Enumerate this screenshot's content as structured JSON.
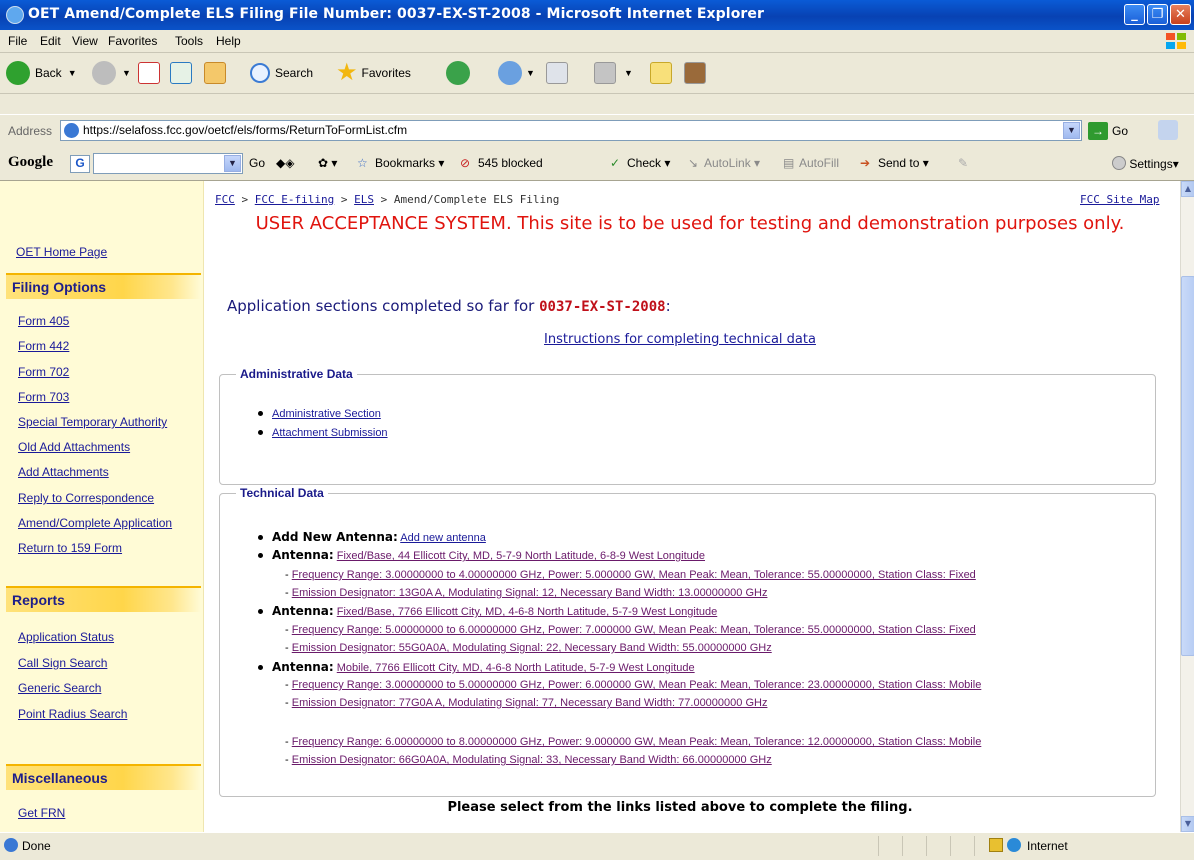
{
  "window": {
    "title": "OET Amend/Complete ELS Filing File Number: 0037-EX-ST-2008 - Microsoft Internet Explorer"
  },
  "menu": [
    "File",
    "Edit",
    "View",
    "Favorites",
    "Tools",
    "Help"
  ],
  "toolbar": {
    "back": "Back",
    "search": "Search",
    "favorites": "Favorites"
  },
  "address": {
    "label": "Address",
    "url": "https://selafoss.fcc.gov/oetcf/els/forms/ReturnToFormList.cfm",
    "go": "Go"
  },
  "google_toolbar": {
    "logo": "Google",
    "go": "Go",
    "bookmarks": "Bookmarks",
    "blocked": "545 blocked",
    "check": "Check",
    "autolink": "AutoLink",
    "autofill": "AutoFill",
    "send_to": "Send to",
    "settings": "Settings"
  },
  "sidebar": {
    "home": "OET Home Page",
    "filing_options_header": "Filing Options",
    "filing_options": [
      "Form 405",
      "Form 442",
      "Form 702",
      "Form 703",
      "Special Temporary Authority",
      "Old Add Attachments",
      "Add Attachments",
      "Reply to Correspondence",
      "Amend/Complete Application",
      "Return to 159 Form"
    ],
    "reports_header": "Reports",
    "reports": [
      "Application Status",
      "Call Sign Search",
      "Generic Search",
      "Point Radius Search"
    ],
    "misc_header": "Miscellaneous",
    "misc": [
      "Get FRN"
    ]
  },
  "breadcrumb": {
    "fcc": "FCC",
    "efiling": "FCC E-filing",
    "els": "ELS",
    "current": "Amend/Complete ELS Filing",
    "sep": " > "
  },
  "site_map": "FCC Site Map",
  "banner": "USER ACCEPTANCE SYSTEM. This site is to be used for testing and demonstration purposes only.",
  "completed_heading": "Application sections completed so far for",
  "file_number": "0037-EX-ST-2008",
  "completed_colon": ":",
  "instructions_link": "Instructions for completing technical data",
  "admin": {
    "legend": "Administrative Data",
    "items": [
      "Administrative Section",
      "Attachment Submission"
    ]
  },
  "technical": {
    "legend": "Technical Data",
    "add_label": "Add New Antenna:",
    "add_link": "Add new antenna",
    "antenna_label": "Antenna:",
    "antennas": [
      {
        "link": "Fixed/Base, 44 Ellicott City, MD, 5-7-9 North Latitude, 6-8-9 West Longitude",
        "freqs": [
          {
            "freq": "Frequency Range: 3.00000000 to 4.00000000 GHz, Power: 5.000000 GW, Mean Peak: Mean, Tolerance: 55.00000000, Station Class: Fixed",
            "emission": "Emission Designator: 13G0A A, Modulating Signal: 12, Necessary Band Width: 13.00000000 GHz"
          }
        ]
      },
      {
        "link": "Fixed/Base, 7766 Ellicott City, MD, 4-6-8 North Latitude, 5-7-9 West Longitude",
        "freqs": [
          {
            "freq": "Frequency Range: 5.00000000 to 6.00000000 GHz, Power: 7.000000 GW, Mean Peak: Mean, Tolerance: 55.00000000, Station Class: Fixed",
            "emission": "Emission Designator: 55G0A0A, Modulating Signal: 22, Necessary Band Width: 55.00000000 GHz"
          }
        ]
      },
      {
        "link": "Mobile, 7766 Ellicott City, MD, 4-6-8 North Latitude, 5-7-9 West Longitude",
        "freqs": [
          {
            "freq": "Frequency Range: 3.00000000 to 5.00000000 GHz, Power: 6.000000 GW, Mean Peak: Mean, Tolerance: 23.00000000, Station Class: Mobile",
            "emission": "Emission Designator: 77G0A A, Modulating Signal: 77, Necessary Band Width: 77.00000000 GHz"
          },
          {
            "freq": "Frequency Range: 6.00000000 to 8.00000000 GHz, Power: 9.000000 GW, Mean Peak: Mean, Tolerance: 12.00000000, Station Class: Mobile",
            "emission": "Emission Designator: 66G0A0A, Modulating Signal: 33, Necessary Band Width: 66.00000000 GHz"
          }
        ]
      }
    ]
  },
  "footer_instruction": "Please select from the links listed above to complete the filing.",
  "status": {
    "text": "Done",
    "zone": "Internet"
  }
}
